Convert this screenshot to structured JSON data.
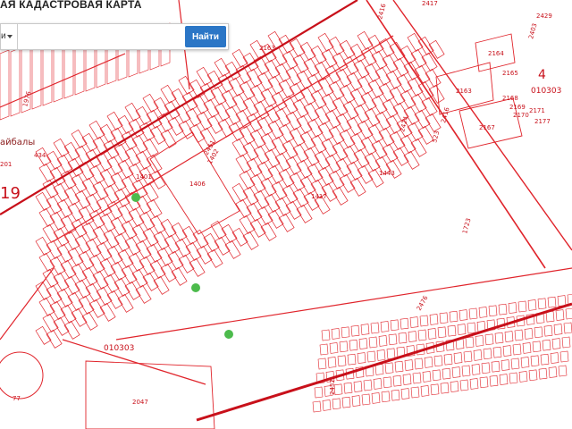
{
  "header": {
    "title": "АЯ КАДАСТРОВАЯ КАРТА"
  },
  "search": {
    "dropdown_value": "и",
    "placeholder": "",
    "button_label": "Найти"
  },
  "map": {
    "colors": {
      "parcel": "#e0242b",
      "block_border": "#c8101a",
      "marker": "#4cbb4c",
      "background": "#ffffff"
    },
    "labels": {
      "quarter_ne": "010303",
      "quarter_ne_digit": "4",
      "quarter_sw": "010303",
      "district_code": "19",
      "place_name": "айбалы",
      "p1406": "1406",
      "p2047": "2047",
      "p2163": "2163",
      "p2164": "2164",
      "p2165": "2165",
      "p2167": "2167",
      "p2416": "2416",
      "p2416b": "2416",
      "p2424": "2424",
      "p523": "523",
      "p1417": "1417",
      "p1723": "1723",
      "p2163b": "2163",
      "p2168": "2168",
      "p2169": "2169",
      "p2170": "2170",
      "p2171": "2171",
      "p2177": "2177",
      "p2403": "2403",
      "p77": "77",
      "p201": "201",
      "p1976": "1976",
      "p434": "434",
      "p1401": "1401",
      "p1402": "1402",
      "p2432": "2432",
      "p2451": "2451",
      "p2476": "2476",
      "p2429": "2429",
      "p2417": "2417",
      "p1443": "1443"
    }
  }
}
